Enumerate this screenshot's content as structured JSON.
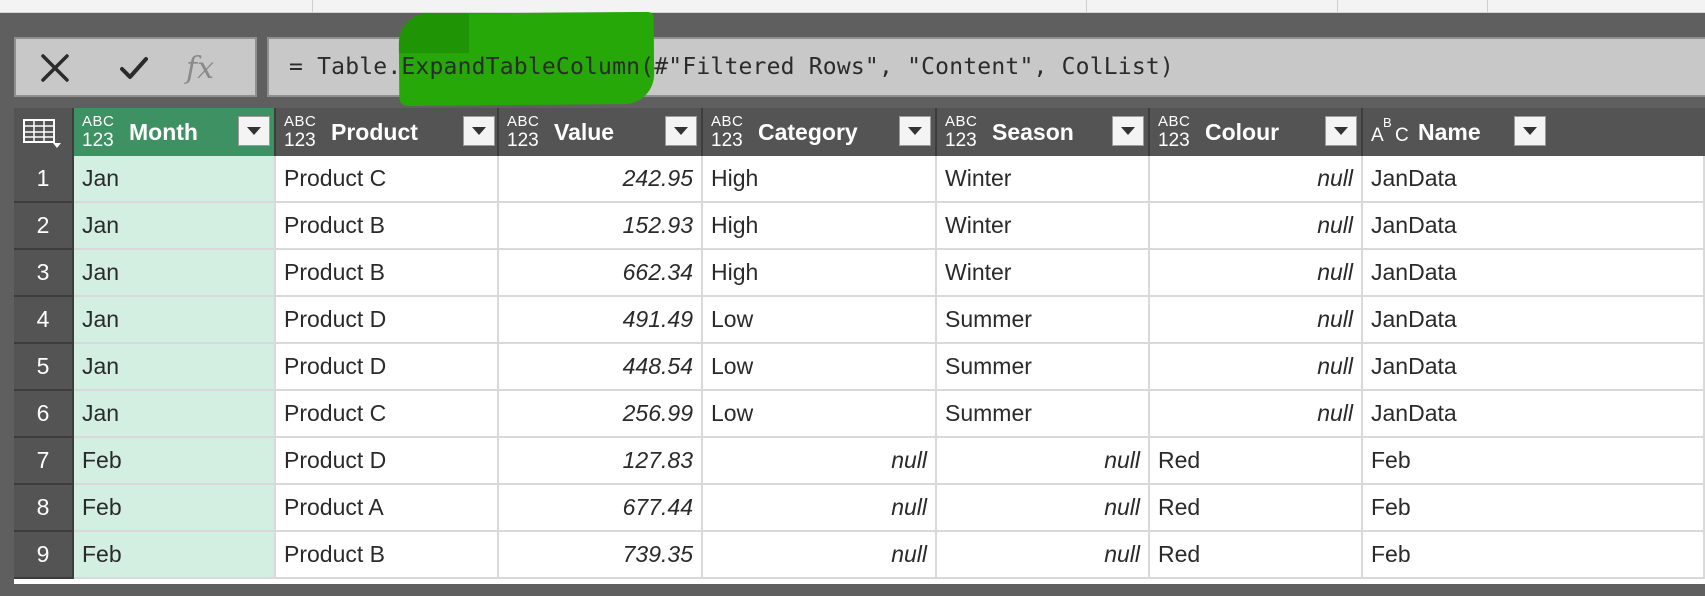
{
  "formula_bar": {
    "cancel_icon": "close-icon",
    "commit_icon": "checkmark-icon",
    "fx_label": "fx",
    "formula": "= Table.ExpandTableColumn(#\"Filtered Rows\", \"Content\", ColList)",
    "highlight_color": "#25a808"
  },
  "columns": [
    {
      "name": "Month",
      "type": "any",
      "type_top": "ABC",
      "type_bottom": "123",
      "selected": true
    },
    {
      "name": "Product",
      "type": "any",
      "type_top": "ABC",
      "type_bottom": "123"
    },
    {
      "name": "Value",
      "type": "any",
      "type_top": "ABC",
      "type_bottom": "123"
    },
    {
      "name": "Category",
      "type": "any",
      "type_top": "ABC",
      "type_bottom": "123"
    },
    {
      "name": "Season",
      "type": "any",
      "type_top": "ABC",
      "type_bottom": "123"
    },
    {
      "name": "Colour",
      "type": "any",
      "type_top": "ABC",
      "type_bottom": "123"
    },
    {
      "name": "Name",
      "type": "text",
      "type_a": "A",
      "type_b": "B",
      "type_c": "C"
    }
  ],
  "rows": [
    {
      "n": "1",
      "Month": "Jan",
      "Product": "Product C",
      "Value": "242.95",
      "Category": "High",
      "Season": "Winter",
      "Colour": "null",
      "Name": "JanData"
    },
    {
      "n": "2",
      "Month": "Jan",
      "Product": "Product B",
      "Value": "152.93",
      "Category": "High",
      "Season": "Winter",
      "Colour": "null",
      "Name": "JanData"
    },
    {
      "n": "3",
      "Month": "Jan",
      "Product": "Product B",
      "Value": "662.34",
      "Category": "High",
      "Season": "Winter",
      "Colour": "null",
      "Name": "JanData"
    },
    {
      "n": "4",
      "Month": "Jan",
      "Product": "Product D",
      "Value": "491.49",
      "Category": "Low",
      "Season": "Summer",
      "Colour": "null",
      "Name": "JanData"
    },
    {
      "n": "5",
      "Month": "Jan",
      "Product": "Product D",
      "Value": "448.54",
      "Category": "Low",
      "Season": "Summer",
      "Colour": "null",
      "Name": "JanData"
    },
    {
      "n": "6",
      "Month": "Jan",
      "Product": "Product C",
      "Value": "256.99",
      "Category": "Low",
      "Season": "Summer",
      "Colour": "null",
      "Name": "JanData"
    },
    {
      "n": "7",
      "Month": "Feb",
      "Product": "Product D",
      "Value": "127.83",
      "Category": "null",
      "Season": "null",
      "Colour": "Red",
      "Name": "Feb"
    },
    {
      "n": "8",
      "Month": "Feb",
      "Product": "Product A",
      "Value": "677.44",
      "Category": "null",
      "Season": "null",
      "Colour": "Red",
      "Name": "Feb"
    },
    {
      "n": "9",
      "Month": "Feb",
      "Product": "Product B",
      "Value": "739.35",
      "Category": "null",
      "Season": "null",
      "Colour": "Red",
      "Name": "Feb"
    }
  ]
}
